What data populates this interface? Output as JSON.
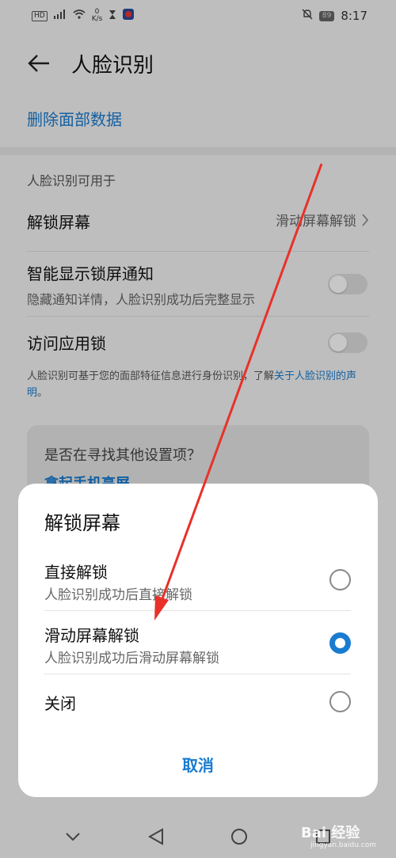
{
  "status_bar": {
    "hd": "HD",
    "net_speed_value": "0",
    "net_speed_unit": "K/s",
    "battery": "89",
    "time": "8:17"
  },
  "header": {
    "title": "人脸识别"
  },
  "delete_link": "删除面部数据",
  "section_header": "人脸识别可用于",
  "rows": {
    "unlock": {
      "title": "解锁屏幕",
      "value": "滑动屏幕解锁"
    },
    "notify": {
      "title": "智能显示锁屏通知",
      "subtitle": "隐藏通知详情，人脸识别成功后完整显示",
      "enabled": false
    },
    "applock": {
      "title": "访问应用锁",
      "enabled": false
    }
  },
  "disclaimer": {
    "text": "人脸识别可基于您的面部特征信息进行身份识别，了解",
    "link": "关于人脸识别的声明",
    "end": "。"
  },
  "suggest": {
    "title": "是否在寻找其他设置项？",
    "link": "拿起手机亮屏"
  },
  "dialog": {
    "title": "解锁屏幕",
    "options": [
      {
        "title": "直接解锁",
        "subtitle": "人脸识别成功后直接解锁",
        "selected": false
      },
      {
        "title": "滑动屏幕解锁",
        "subtitle": "人脸识别成功后滑动屏幕解锁",
        "selected": true
      },
      {
        "title": "关闭",
        "subtitle": "",
        "selected": false
      }
    ],
    "cancel_label": "取消"
  },
  "watermark": {
    "brand": "Bai 经验",
    "url": "jingyan.baidu.com"
  },
  "colors": {
    "accent": "#1a7bd0",
    "arrow": "#e8312a"
  }
}
